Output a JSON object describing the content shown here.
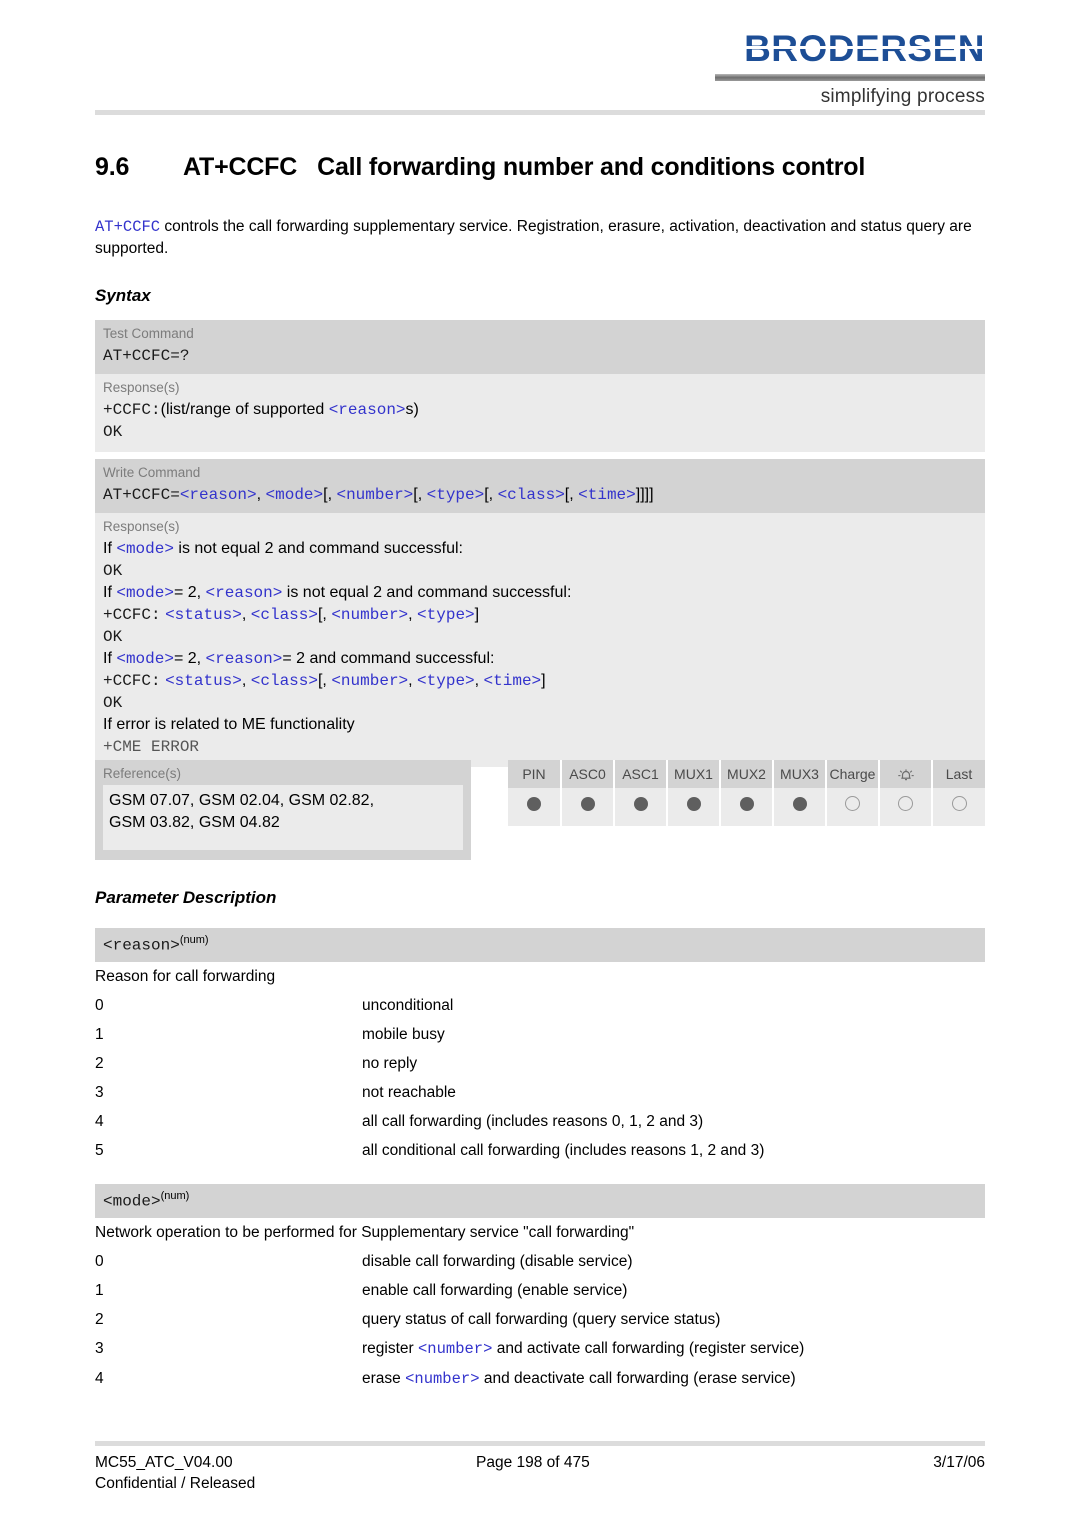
{
  "header": {
    "logo_text": "BRODERSEN",
    "logo_tagline": "simplifying process",
    "logo_color": "#1d4e96"
  },
  "title": {
    "number": "9.6",
    "command": "AT+CCFC",
    "text": "Call forwarding number and conditions control"
  },
  "intro": {
    "command": "AT+CCFC",
    "text": " controls the call forwarding supplementary service. Registration, erasure, activation, deactivation and status query are supported."
  },
  "sections": {
    "syntax": "Syntax",
    "parameter_description": "Parameter Description"
  },
  "syntax": {
    "test_command": {
      "label": "Test Command",
      "line": "AT+CCFC=?",
      "response_label": "Response(s)",
      "response_prefix": "+CCFC:",
      "response_text_a": "(list/range of supported ",
      "response_param": "<reason>",
      "response_text_b": "s)",
      "response_ok": "OK"
    },
    "write_command": {
      "label": "Write Command",
      "syntax_prefix": "AT+CCFC=",
      "syntax_full": "AT+CCFC=<reason>, <mode>[, <number>[, <type>[, <class>[, <time>]]]]",
      "response_label": "Response(s)",
      "lines": [
        "If <mode> is not equal 2 and command successful:",
        "OK",
        "If <mode>= 2, <reason> is not equal 2 and command successful:",
        "+CCFC: <status>, <class>[, <number>, <type>]",
        "OK",
        "If <mode>= 2, <reason>= 2 and command successful:",
        "+CCFC: <status>, <class>[, <number>, <type>, <time>]",
        "OK",
        "If error is related to ME functionality",
        "+CME ERROR"
      ]
    },
    "references": {
      "label": "Reference(s)",
      "line1": "GSM 07.07, GSM 02.04, GSM 02.82,",
      "line2": "GSM 03.82, GSM 04.82"
    },
    "capabilities": {
      "headers": [
        "PIN",
        "ASC0",
        "ASC1",
        "MUX1",
        "MUX2",
        "MUX3",
        "Charge",
        "alarm-bell-icon",
        "Last"
      ],
      "values": [
        true,
        true,
        true,
        true,
        true,
        true,
        false,
        false,
        false
      ]
    }
  },
  "parameters": [
    {
      "name": "<reason>",
      "type": "(num)",
      "description": "Reason for call forwarding",
      "options": [
        {
          "key": "0",
          "value": "unconditional"
        },
        {
          "key": "1",
          "value": "mobile busy"
        },
        {
          "key": "2",
          "value": "no reply"
        },
        {
          "key": "3",
          "value": "not reachable"
        },
        {
          "key": "4",
          "value": "all call forwarding (includes reasons 0, 1, 2 and 3)"
        },
        {
          "key": "5",
          "value": "all conditional call forwarding (includes reasons 1, 2 and 3)"
        }
      ]
    },
    {
      "name": "<mode>",
      "type": "(num)",
      "description": "Network operation to be performed for Supplementary service \"call forwarding\"",
      "options": [
        {
          "key": "0",
          "value": "disable call forwarding (disable service)"
        },
        {
          "key": "1",
          "value": "enable call forwarding (enable service)"
        },
        {
          "key": "2",
          "value": "query status of call forwarding (query service status)"
        },
        {
          "key": "3",
          "value": "register <number> and activate call forwarding (register service)",
          "param": "<number>",
          "before": "register ",
          "after": " and activate call forwarding (register service)"
        },
        {
          "key": "4",
          "value": "erase <number> and deactivate call forwarding (erase service)",
          "param": "<number>",
          "before": "erase ",
          "after": " and deactivate call forwarding (erase service)"
        }
      ]
    }
  ],
  "footer": {
    "doc_id": "MC55_ATC_V04.00",
    "classification": "Confidential / Released",
    "page": "Page 198 of 475",
    "date": "3/17/06"
  }
}
